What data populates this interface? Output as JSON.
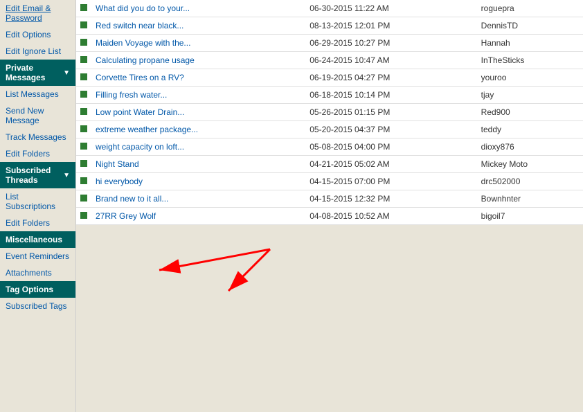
{
  "sidebar": {
    "items_top": [
      {
        "label": "Edit Email & Password",
        "href": "#"
      },
      {
        "label": "Edit Options",
        "href": "#"
      },
      {
        "label": "Edit Ignore List",
        "href": "#"
      }
    ],
    "sections": [
      {
        "title": "Private Messages",
        "has_arrow": true,
        "items": [
          {
            "label": "List Messages"
          },
          {
            "label": "Send New Message"
          },
          {
            "label": "Track Messages"
          },
          {
            "label": "Edit Folders"
          }
        ]
      },
      {
        "title": "Subscribed Threads",
        "has_arrow": true,
        "items": [
          {
            "label": "List Subscriptions"
          },
          {
            "label": "Edit Folders"
          }
        ]
      },
      {
        "title": "Miscellaneous",
        "has_arrow": false,
        "items": [
          {
            "label": "Event Reminders"
          },
          {
            "label": "Attachments"
          }
        ]
      },
      {
        "title": "Tag Options",
        "has_arrow": false,
        "items": [
          {
            "label": "Subscribed Tags"
          }
        ]
      }
    ]
  },
  "threads": [
    {
      "title": "What did you do to your...",
      "date": "06-30-2015 11:22 AM",
      "author": "roguepra"
    },
    {
      "title": "Red switch near black...",
      "date": "08-13-2015 12:01 PM",
      "author": "DennisTD"
    },
    {
      "title": "Maiden Voyage with the...",
      "date": "06-29-2015 10:27 PM",
      "author": "Hannah"
    },
    {
      "title": "Calculating propane usage",
      "date": "06-24-2015 10:47 AM",
      "author": "InTheSticks"
    },
    {
      "title": "Corvette Tires on a RV?",
      "date": "06-19-2015 04:27 PM",
      "author": "youroo"
    },
    {
      "title": "Filling fresh water...",
      "date": "06-18-2015 10:14 PM",
      "author": "tjay"
    },
    {
      "title": "Low point Water Drain...",
      "date": "05-26-2015 01:15 PM",
      "author": "Red900"
    },
    {
      "title": "extreme weather package...",
      "date": "05-20-2015 04:37 PM",
      "author": "teddy"
    },
    {
      "title": "weight capacity on loft...",
      "date": "05-08-2015 04:00 PM",
      "author": "dioxy876"
    },
    {
      "title": "Night Stand",
      "date": "04-21-2015 05:02 AM",
      "author": "Mickey Moto"
    },
    {
      "title": "hi everybody",
      "date": "04-15-2015 07:00 PM",
      "author": "drc502000"
    },
    {
      "title": "Brand new to it all...",
      "date": "04-15-2015 12:32 PM",
      "author": "Bownhnter"
    },
    {
      "title": "27RR Grey Wolf",
      "date": "04-08-2015 10:52 AM",
      "author": "bigoil7"
    }
  ]
}
